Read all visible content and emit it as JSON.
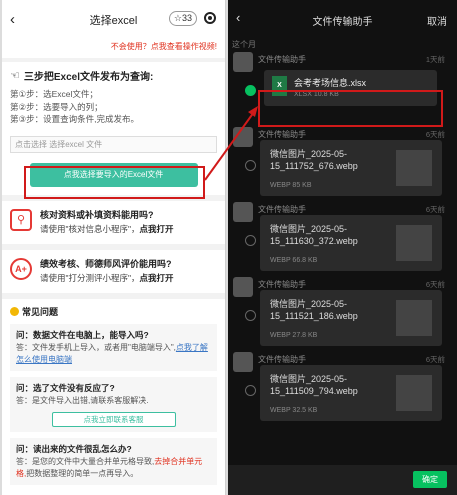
{
  "left": {
    "title": "选择excel",
    "star_count": "☆33",
    "notice": "不会使用？点我查看操作视频!",
    "steps_heading": "三步把Excel文件发布为查询:",
    "steps": [
      "第①步：选Excel文件；",
      "第②步：选要导入的列；",
      "第③步：设置查询条件,完成发布。"
    ],
    "pick_placeholder": "点击选择 选择excel 文件",
    "pick_button": "点我选择要导入的Excel文件",
    "card1_title": "核对资料或补填资料能用吗?",
    "card1_text": "请使用\"核对信息小程序\"，",
    "card1_link": "点我打开",
    "card2_title": "绩效考核、师德师风评价能用吗?",
    "card2_text": "请使用\"打分测评小程序\"，",
    "card2_link": "点我打开",
    "faq_title": "常见问题",
    "faq": [
      {
        "q": "问：数据文件在电脑上，能导入吗?",
        "a": "答：文件发手机上导入，或者用\"电脑端导入\",",
        "link": "点我了解怎么使用电脑端",
        "btn": ""
      },
      {
        "q": "问：选了文件没有反应了?",
        "a": "答：是文件导入出错,请联系客服解决.",
        "link": "",
        "btn": "点我立即联系客服"
      },
      {
        "q": "问：读出来的文件很乱怎么办?",
        "a": "答：是您的文件中大量合并单元格导致,",
        "red": "去掉合并单元格,",
        "a2": "把数据整理的简单一点再导入。",
        "link": "",
        "btn": ""
      }
    ]
  },
  "right": {
    "title": "文件传输助手",
    "cancel": "取消",
    "today": "这个月",
    "ok_button": "确定",
    "items": [
      {
        "sender": "文件传输助手",
        "time": "1天前",
        "name": "会考考场信息.xlsx",
        "meta": "XLSX 10.8 KB",
        "type": "xlsx"
      },
      {
        "sender": "文件传输助手",
        "time": "6天前",
        "name": "微信图片_2025-05-15_111752_676.webp",
        "meta": "WEBP 85 KB",
        "type": "img"
      },
      {
        "sender": "文件传输助手",
        "time": "6天前",
        "name": "微信图片_2025-05-15_111630_372.webp",
        "meta": "WEBP 66.8 KB",
        "type": "img"
      },
      {
        "sender": "文件传输助手",
        "time": "6天前",
        "name": "微信图片_2025-05-15_111521_186.webp",
        "meta": "WEBP 27.8 KB",
        "type": "img"
      },
      {
        "sender": "文件传输助手",
        "time": "6天前",
        "name": "微信图片_2025-05-15_111509_794.webp",
        "meta": "WEBP 32.5 KB",
        "type": "img"
      }
    ]
  }
}
